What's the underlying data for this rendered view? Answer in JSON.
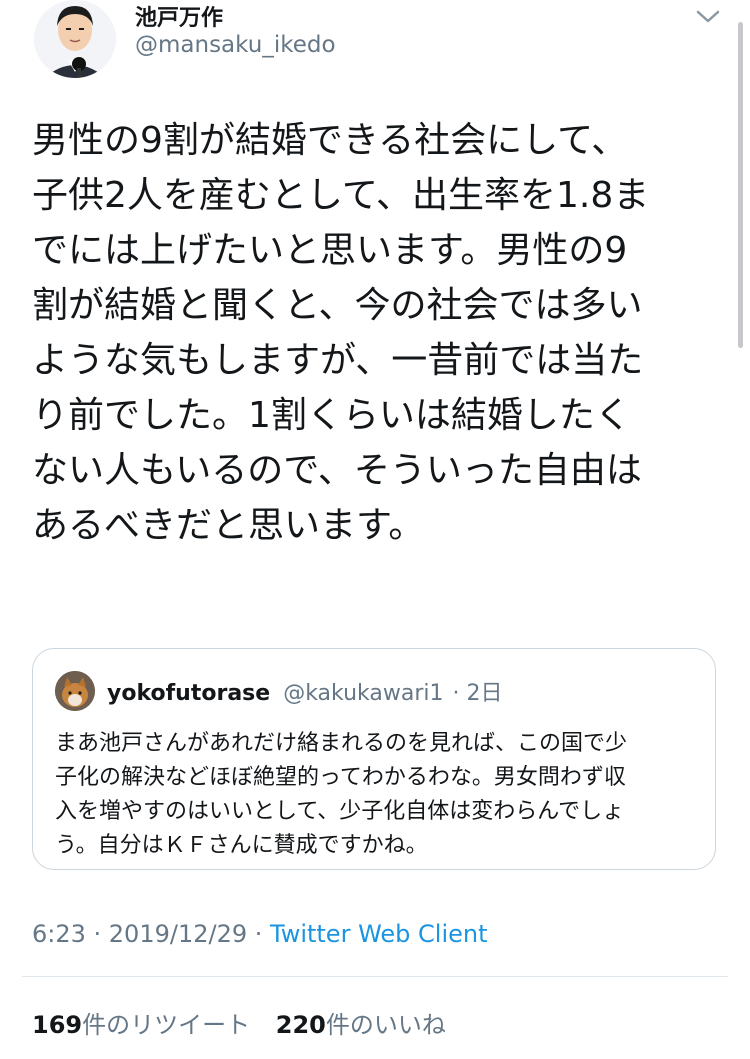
{
  "author": {
    "display_name": "池戸万作",
    "handle": "@mansaku_ikedo"
  },
  "tweet": {
    "lines": [
      "男性の9割が結婚できる社会にして、",
      "子供2人を産むとして、出生率を1.8ま",
      "でには上げたいと思います。男性の9",
      "割が結婚と聞くと、今の社会では多い",
      "ような気もしますが、一昔前では当た",
      "り前でした。1割くらいは結婚したく",
      "ない人もいるので、そういった自由は",
      "あるべきだと思います。"
    ]
  },
  "quoted": {
    "name": "yokofutorase",
    "handle": "@kakukawari1",
    "time": "· 2日",
    "lines": [
      "まあ池戸さんがあれだけ絡まれるのを見れば、この国で少",
      "子化の解決などほぼ絶望的ってわかるわな。男女問わず収",
      "入を増やすのはいいとして、少子化自体は変わらんでしょ",
      "う。自分はＫＦさんに賛成ですかね。"
    ]
  },
  "meta": {
    "timestamp": "6:23 · 2019/12/29 · ",
    "client": "Twitter Web Client"
  },
  "stats": {
    "retweets_count": "169",
    "retweets_label": "件のリツイート",
    "likes_count": "220",
    "likes_label": "件のいいね"
  },
  "icons": {
    "caret": "chevron-down-icon"
  },
  "colors": {
    "link": "#1b95e0",
    "secondary_text": "#657786",
    "border": "#ccd6dd"
  }
}
